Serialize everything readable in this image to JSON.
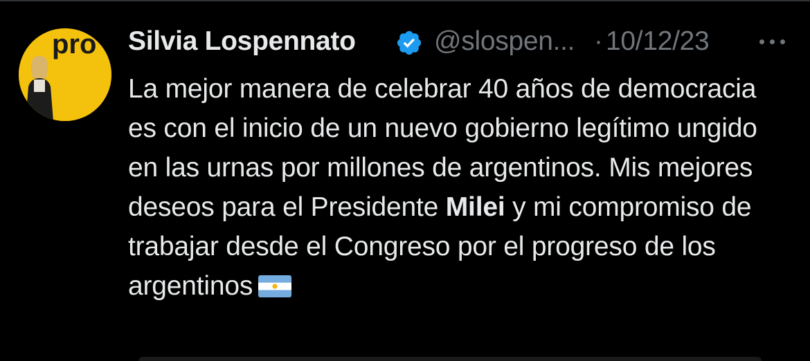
{
  "tweet": {
    "author": {
      "display_name": "Silvia Lospennato",
      "handle": "@slospen...",
      "verified": true,
      "avatar_logo_text": "pro"
    },
    "separator": "·",
    "date": "10/12/23",
    "text": {
      "part1": "La mejor manera de celebrar 40 años de democracia es con el inicio de un nuevo gobierno legítimo ungido en las urnas por millones de argentinos. Mis mejores deseos para el Presidente ",
      "bold": "Milei",
      "part2": " y mi compromiso de trabajar desde el Congreso por el progreso de los argentinos"
    },
    "emoji": "argentina-flag-icon"
  },
  "colors": {
    "background": "#000000",
    "text": "#e7e9ea",
    "secondary": "#71767b",
    "verified": "#1d9bf0",
    "avatar_bg": "#f4c20d",
    "flag_blue": "#74acdf"
  }
}
